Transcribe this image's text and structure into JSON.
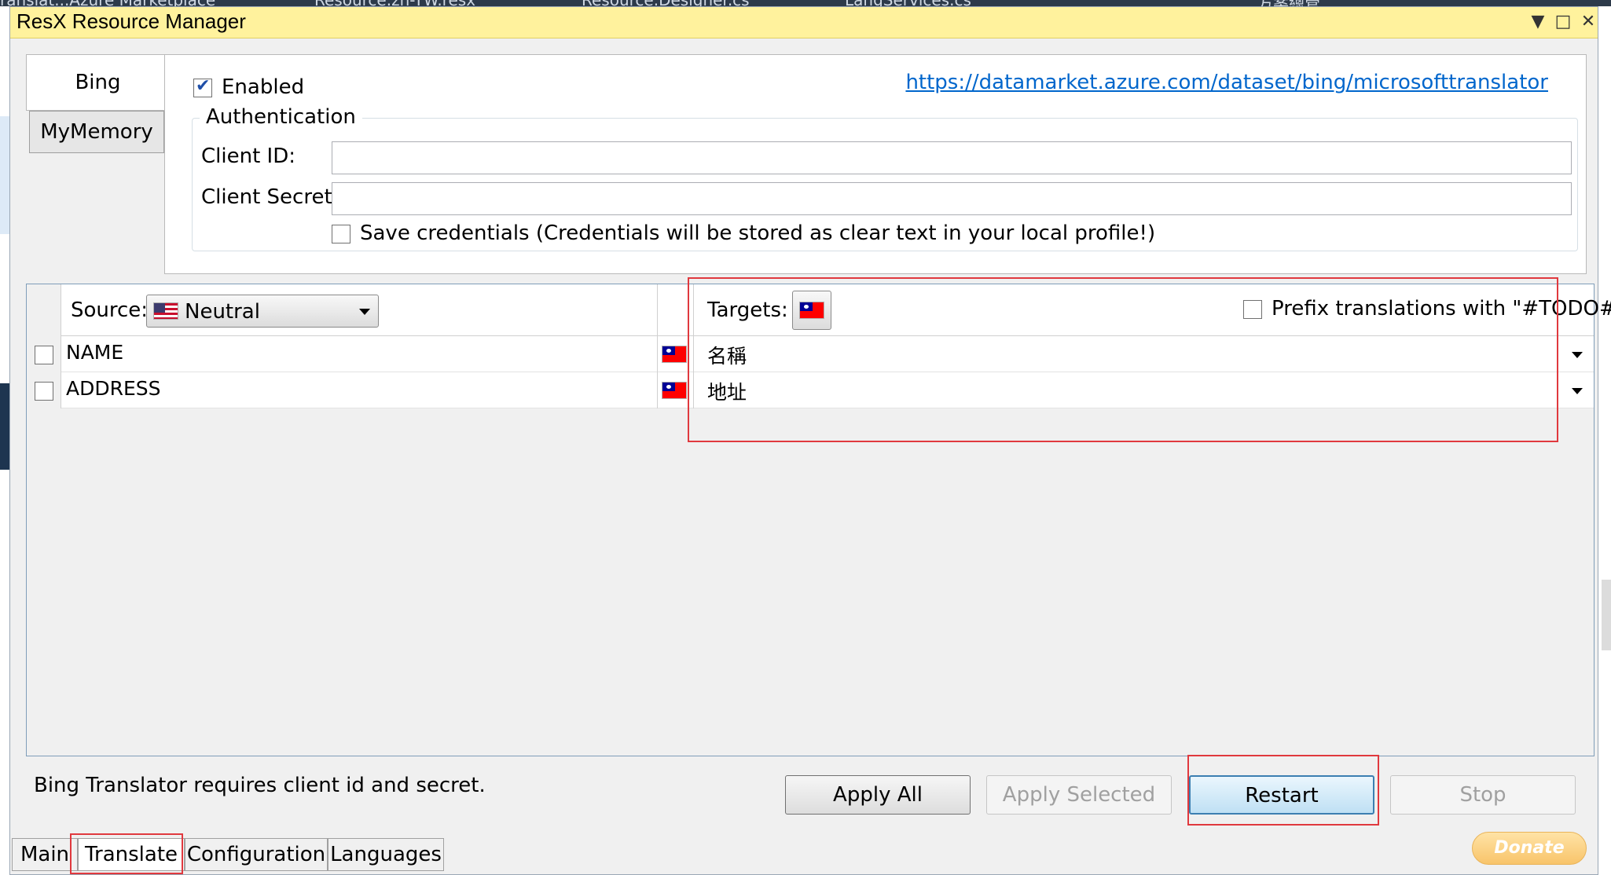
{
  "window": {
    "title": "ResX Resource Manager"
  },
  "background_tabs": [
    "ranslat...Azure Marketplace",
    "Resource.zh-TW.resx",
    "Resource.Designer.cs",
    "LangServices.cs",
    "方案總管"
  ],
  "provider_tabs": [
    {
      "label": "Bing",
      "selected": true
    },
    {
      "label": "MyMemory",
      "selected": false
    }
  ],
  "bing": {
    "enabled_label": "Enabled",
    "enabled_checked": true,
    "link": "https://datamarket.azure.com/dataset/bing/microsofttranslator",
    "auth_title": "Authentication",
    "client_id_label": "Client ID:",
    "client_id_value": "",
    "client_secret_label": "Client Secret:",
    "client_secret_value": "",
    "save_credentials_label": "Save credentials (Credentials will be stored as clear text in your local profile!)",
    "save_credentials_checked": false
  },
  "grid": {
    "source_label": "Source:",
    "source_value": "Neutral",
    "targets_label": "Targets:",
    "prefix_label": "Prefix translations with \"#TODO#_\"",
    "prefix_checked": false,
    "rows": [
      {
        "key": "NAME",
        "translation": "名稱"
      },
      {
        "key": "ADDRESS",
        "translation": "地址"
      }
    ]
  },
  "status_message": "Bing Translator requires client id and secret.",
  "buttons": {
    "apply_all": "Apply All",
    "apply_selected": "Apply Selected",
    "restart": "Restart",
    "stop": "Stop"
  },
  "bottom_tabs": [
    {
      "label": "Main",
      "selected": false
    },
    {
      "label": "Translate",
      "selected": true
    },
    {
      "label": "Configuration",
      "selected": false
    },
    {
      "label": "Languages",
      "selected": false
    }
  ],
  "donate_label": "Donate",
  "colors": {
    "titlebar": "#fff29d",
    "highlight": "#e0393e",
    "link": "#0066cc"
  }
}
